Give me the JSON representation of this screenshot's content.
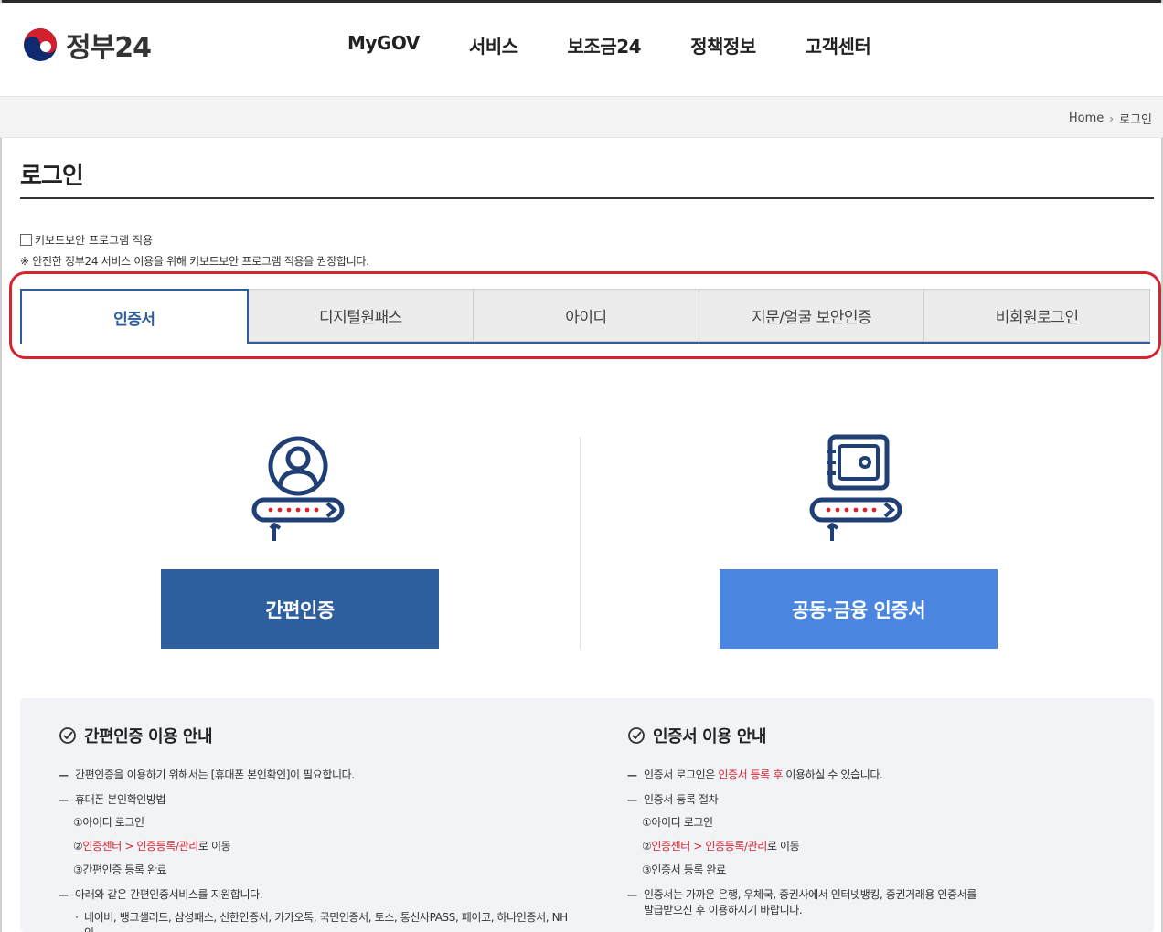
{
  "header": {
    "logo_text": "정부24",
    "nav": [
      "MyGOV",
      "서비스",
      "보조금24",
      "정책정보",
      "고객센터"
    ]
  },
  "breadcrumb": {
    "home": "Home",
    "sep": "›",
    "current": "로그인"
  },
  "page": {
    "title": "로그인"
  },
  "keyboard_security": {
    "label": "키보드보안 프로그램 적용",
    "checked": false,
    "note": "※ 안전한 정부24 서비스 이용을 위해 키보드보안 프로그램 적용을 권장합니다."
  },
  "tabs": [
    {
      "label": "인증서",
      "active": true
    },
    {
      "label": "디지털원패스",
      "active": false
    },
    {
      "label": "아이디",
      "active": false
    },
    {
      "label": "지문/얼굴 보안인증",
      "active": false
    },
    {
      "label": "비회원로그인",
      "active": false
    }
  ],
  "login_options": {
    "simple_label": "간편인증",
    "cert_label": "공동·금융 인증서"
  },
  "colors": {
    "simple_button": "#2d5e9d",
    "cert_button": "#4a86e0",
    "tab_active": "#2d5e9d",
    "highlight": "#d6252f",
    "emphasis_red": "#d6252f"
  },
  "info_simple": {
    "title": "간편인증 이용 안내",
    "item1": "간편인증을 이용하기 위해서는 [휴대폰 본인확인]이 필요합니다.",
    "item2": "휴대폰 본인확인방법",
    "step1": "①아이디 로그인",
    "step2_prefix": "②",
    "step2_red": "인증센터 > 인증등록/관리",
    "step2_suffix": "로 이동",
    "step3": "③간편인증 등록 완료",
    "item3": "아래와 같은 간편인증서비스를 지원합니다.",
    "providers": "네이버, 뱅크샐러드, 삼성패스, 신한인증서, 카카오톡, 국민인증서, 토스, 통신사PASS, 페이코, 하나인증서, NH인"
  },
  "info_cert": {
    "title": "인증서 이용 안내",
    "item1_prefix": "인증서 로그인은 ",
    "item1_red": "인증서 등록 후",
    "item1_suffix": " 이용하실 수 있습니다.",
    "item2": "인증서 등록 절차",
    "step1": "①아이디 로그인",
    "step2_prefix": "②",
    "step2_red": "인증센터 > 인증등록/관리",
    "step2_suffix": "로 이동",
    "step3": "③인증서 등록 완료",
    "item3": "인증서는 가까운 은행, 우체국, 증권사에서 인터넷뱅킹, 증권거래용 인증서를",
    "item3b": "발급받으신 후 이용하시기 바랍니다."
  }
}
